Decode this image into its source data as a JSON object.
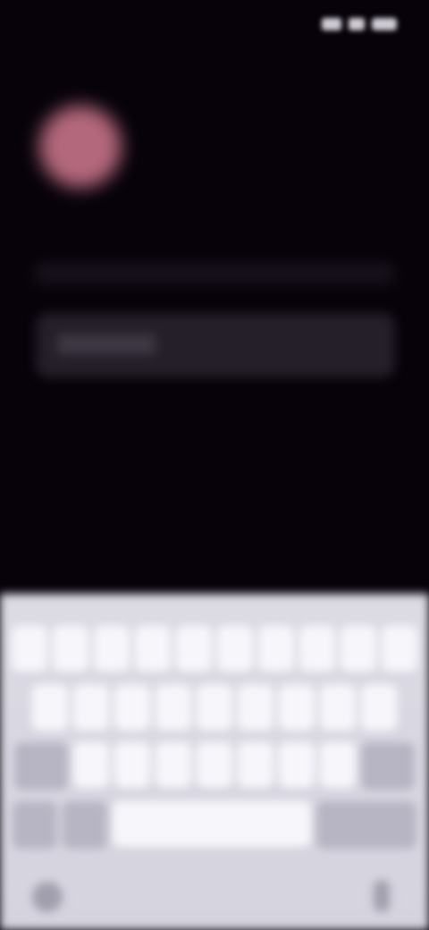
{
  "status_bar": {
    "time": "",
    "signal_icon": "cellular-signal-icon",
    "wifi_icon": "wifi-icon",
    "battery_icon": "battery-icon"
  },
  "content": {
    "avatar_icon": "profile-avatar",
    "title": "",
    "subtitle": "",
    "input_placeholder": ""
  },
  "keyboard": {
    "row1": [
      "",
      "",
      "",
      "",
      "",
      "",
      "",
      "",
      "",
      ""
    ],
    "row2": [
      "",
      "",
      "",
      "",
      "",
      "",
      "",
      "",
      ""
    ],
    "row3": [
      "",
      "",
      "",
      "",
      "",
      "",
      ""
    ],
    "space_label": "",
    "globe_icon": "globe-icon",
    "mic_icon": "microphone-icon"
  },
  "colors": {
    "background": "#07020a",
    "avatar": "#b4687c",
    "input_background": "#241f29",
    "keyboard_background": "#d8d7e1",
    "key": "#f7f6fb",
    "key_dark": "#b7b5c3"
  }
}
